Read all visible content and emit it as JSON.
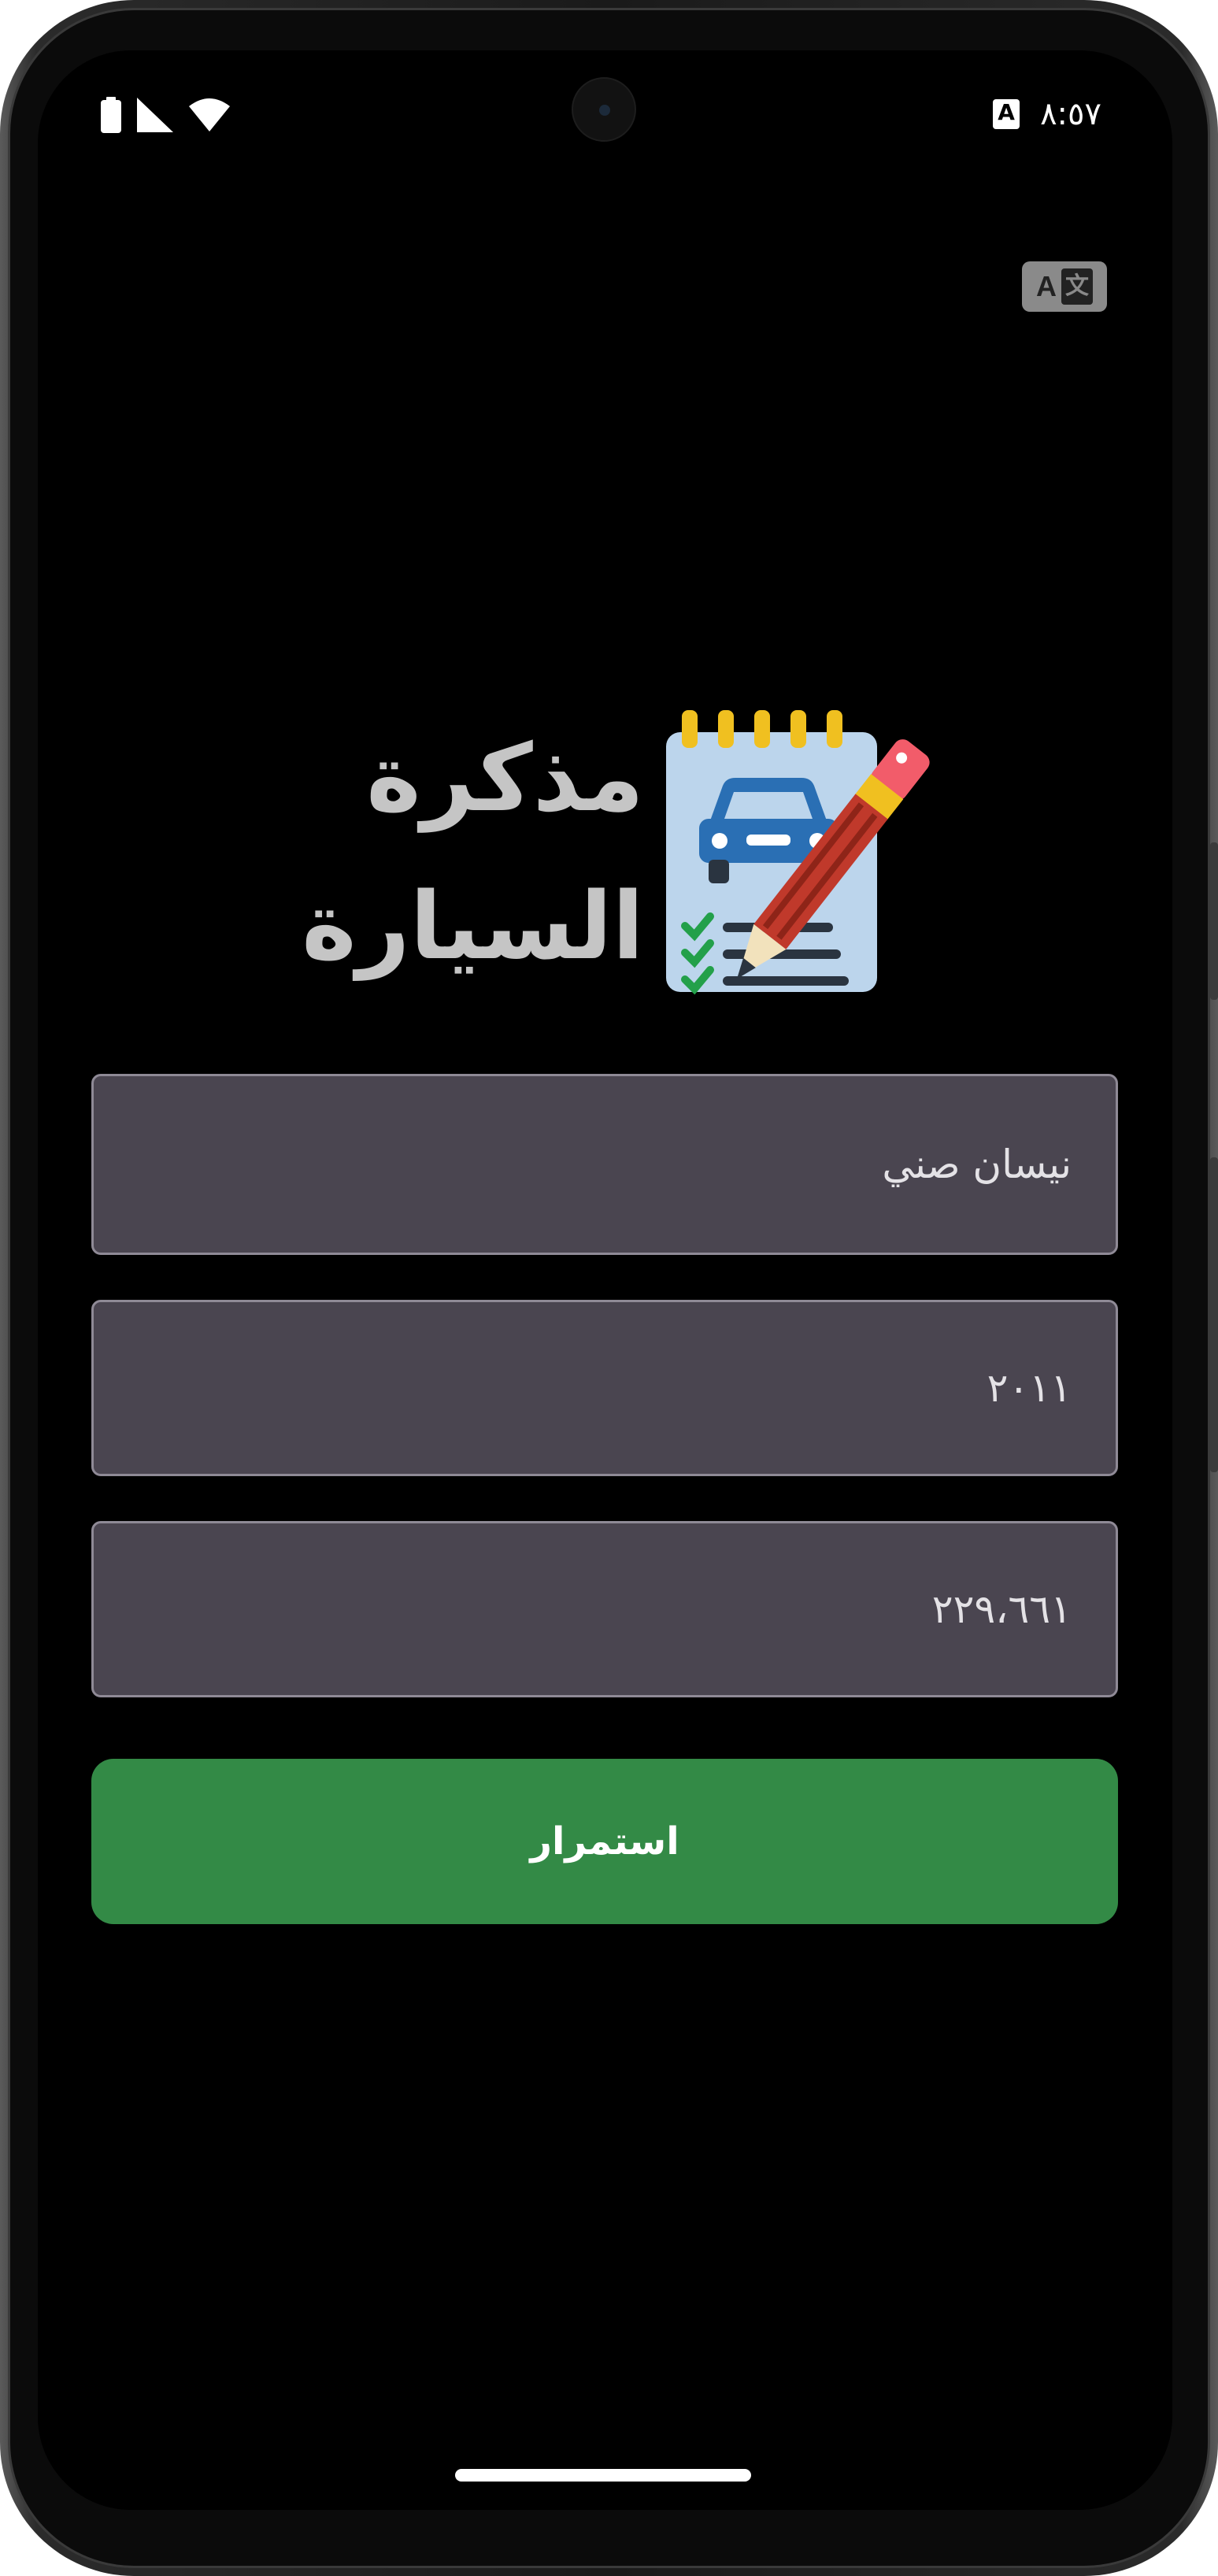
{
  "status_bar": {
    "time": "٨:٥٧",
    "notification_badge": "A",
    "icons": [
      "battery-icon",
      "signal-icon",
      "wifi-icon"
    ]
  },
  "header": {
    "translate_icon": "translate-icon"
  },
  "app": {
    "title_line1": "مذكرة",
    "title_line2": "السيارة",
    "logo_icon": "car-notebook-pencil-icon"
  },
  "form": {
    "car_model_value": "نيسان صني",
    "year_value": "٢٠١١",
    "mileage_value": "٢٢٩،٦٦١",
    "continue_label": "استمرار"
  },
  "colors": {
    "background": "#000000",
    "field_bg": "#4a4550",
    "button_green": "#338a46",
    "title_gray": "#c5c5c5"
  }
}
